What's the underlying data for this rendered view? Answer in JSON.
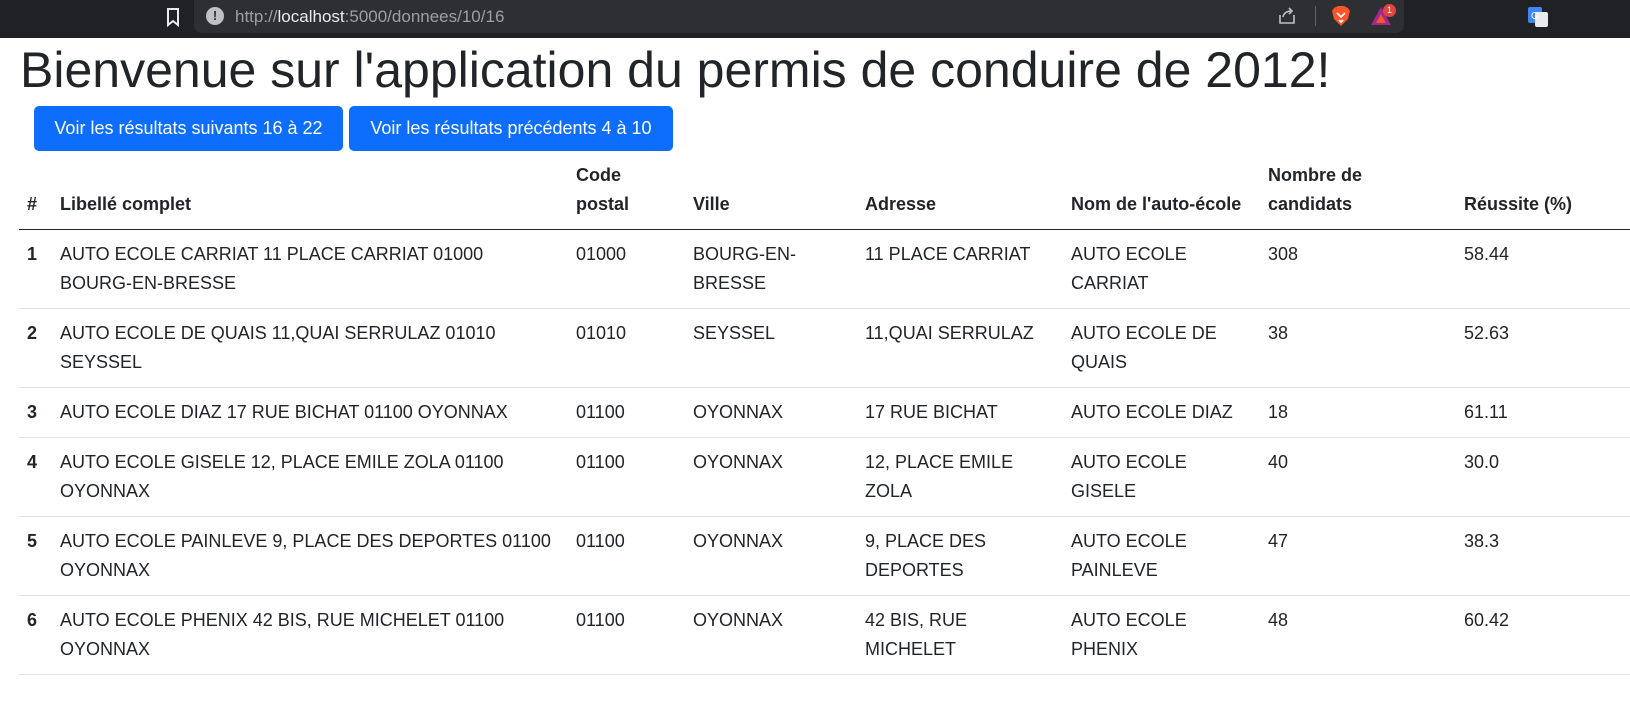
{
  "browser": {
    "url_scheme": "http://",
    "url_host": "localhost",
    "url_rest": ":5000/donnees/10/16",
    "rewards_badge": "1",
    "icons": [
      "bookmark-icon",
      "site-info-icon",
      "share-icon",
      "brave-shields-icon",
      "brave-rewards-icon",
      "translate-icon"
    ]
  },
  "page": {
    "title": "Bienvenue sur l'application du permis de conduire de 2012!",
    "next_button": "Voir les résultats suivants 16 à 22",
    "prev_button": "Voir les résultats précédents 4 à 10"
  },
  "table": {
    "headers": [
      "#",
      "Libellé complet",
      "Code postal",
      "Ville",
      "Adresse",
      "Nom de l'auto-école",
      "Nombre de candidats",
      "Réussite (%)"
    ],
    "rows": [
      [
        "1",
        "AUTO ECOLE CARRIAT 11 PLACE CARRIAT 01000 BOURG-EN-BRESSE",
        "01000",
        "BOURG-EN-BRESSE",
        "11 PLACE CARRIAT",
        "AUTO ECOLE CARRIAT",
        "308",
        "58.44"
      ],
      [
        "2",
        "AUTO ECOLE DE QUAIS 11,QUAI SERRULAZ 01010 SEYSSEL",
        "01010",
        "SEYSSEL",
        "11,QUAI SERRULAZ",
        "AUTO ECOLE DE QUAIS",
        "38",
        "52.63"
      ],
      [
        "3",
        "AUTO ECOLE DIAZ 17 RUE BICHAT 01100 OYONNAX",
        "01100",
        "OYONNAX",
        "17 RUE BICHAT",
        "AUTO ECOLE DIAZ",
        "18",
        "61.11"
      ],
      [
        "4",
        "AUTO ECOLE GISELE 12, PLACE EMILE ZOLA 01100 OYONNAX",
        "01100",
        "OYONNAX",
        "12, PLACE EMILE ZOLA",
        "AUTO ECOLE GISELE",
        "40",
        "30.0"
      ],
      [
        "5",
        "AUTO ECOLE PAINLEVE 9, PLACE DES DEPORTES 01100 OYONNAX",
        "01100",
        "OYONNAX",
        "9, PLACE DES DEPORTES",
        "AUTO ECOLE PAINLEVE",
        "47",
        "38.3"
      ],
      [
        "6",
        "AUTO ECOLE PHENIX 42 BIS, RUE MICHELET 01100 OYONNAX",
        "01100",
        "OYONNAX",
        "42 BIS, RUE MICHELET",
        "AUTO ECOLE PHENIX",
        "48",
        "60.42"
      ]
    ]
  },
  "colors": {
    "primary": "#0d6efd",
    "chrome_bg": "#202124",
    "text": "#212529"
  }
}
